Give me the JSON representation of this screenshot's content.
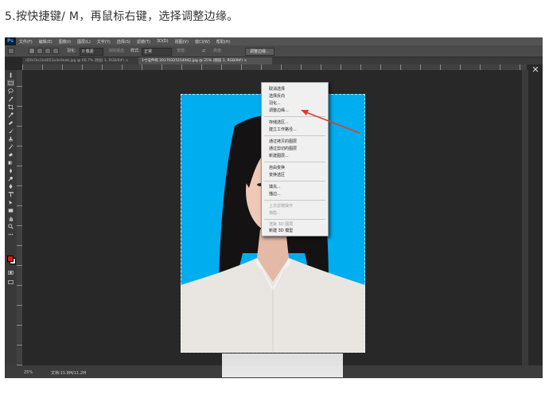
{
  "caption": "5.按快捷键/ M，再鼠标右键，选择调整边缘。",
  "app": {
    "logo": "Ps",
    "menu": [
      "文件(F)",
      "编辑(E)",
      "图像(I)",
      "图层(L)",
      "文字(Y)",
      "选择(S)",
      "滤镜(T)",
      "3D(D)",
      "视图(V)",
      "窗口(W)",
      "帮助(H)"
    ],
    "options": {
      "feather_label": "羽化:",
      "feather_value": "0 像素",
      "antialias_label": "消除锯齿",
      "style_label": "样式:",
      "style_value": "正常",
      "width_label": "宽度:",
      "height_label": "高度:",
      "refine_button": "调整边缘..."
    },
    "tabs": [
      {
        "label": "d2fa7bc1b4651e4e9eab.jpg @ 66.7% (图层 1, RGB/8#) ×",
        "active": false
      },
      {
        "label": "1寸证件照 20170325154942.jpg @ 25% (图层 1, RGB/8#) ×",
        "active": true
      }
    ],
    "status": {
      "zoom": "25%",
      "doc": "文档:15.8M/11.2M"
    }
  },
  "context_menu": {
    "items": [
      {
        "label": "取消选择",
        "enabled": true
      },
      {
        "label": "选择反向",
        "enabled": true
      },
      {
        "label": "羽化...",
        "enabled": true
      },
      {
        "label": "调整边缘...",
        "enabled": true
      },
      {
        "label": "存储选区...",
        "enabled": true
      },
      {
        "label": "建立工作路径...",
        "enabled": true
      },
      {
        "label": "通过拷贝的图层",
        "enabled": true
      },
      {
        "label": "通过剪切的图层",
        "enabled": true
      },
      {
        "label": "新建图层...",
        "enabled": true
      },
      {
        "label": "自由变换",
        "enabled": true
      },
      {
        "label": "变换选区",
        "enabled": true
      },
      {
        "label": "填充...",
        "enabled": true
      },
      {
        "label": "描边...",
        "enabled": true
      },
      {
        "label": "上次滤镜操作",
        "enabled": false
      },
      {
        "label": "渐隐...",
        "enabled": false
      },
      {
        "label": "渲染 3D 图层",
        "enabled": false
      },
      {
        "label": "新建 3D 模型",
        "enabled": true
      }
    ]
  },
  "colors": {
    "photo_background": "#00adef",
    "annotation_arrow": "#e03c2c",
    "foreground_color": "#e51616",
    "background_color": "#ffffff"
  },
  "icons": {
    "tools": [
      "move-tool-icon",
      "marquee-tool-icon",
      "lasso-tool-icon",
      "quick-select-tool-icon",
      "crop-tool-icon",
      "eyedropper-tool-icon",
      "healing-brush-icon",
      "brush-tool-icon",
      "clone-stamp-icon",
      "history-brush-icon",
      "eraser-tool-icon",
      "gradient-tool-icon",
      "blur-tool-icon",
      "dodge-tool-icon",
      "pen-tool-icon",
      "type-tool-icon",
      "path-select-icon",
      "rectangle-tool-icon",
      "hand-tool-icon",
      "zoom-tool-icon",
      "more-tools-icon"
    ]
  }
}
